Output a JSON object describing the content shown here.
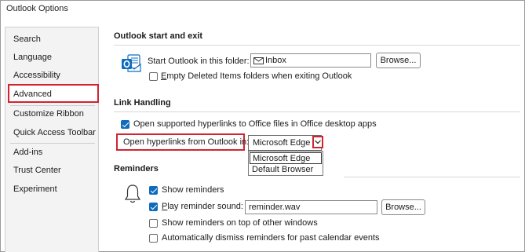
{
  "window": {
    "title": "Outlook Options"
  },
  "sidebar": {
    "items": [
      {
        "label": "Search"
      },
      {
        "label": "Language"
      },
      {
        "label": "Accessibility"
      },
      {
        "label": "Advanced"
      },
      {
        "label": "Customize Ribbon"
      },
      {
        "label": "Quick Access Toolbar"
      },
      {
        "label": "Add-ins"
      },
      {
        "label": "Trust Center"
      },
      {
        "label": "Experiment"
      }
    ],
    "selected": "Advanced"
  },
  "start_exit": {
    "title": "Outlook start and exit",
    "start_folder_label": "Start Outlook in this folder:",
    "start_folder_value": "Inbox",
    "browse_label": "Browse...",
    "empty_deleted_label": "Empty Deleted Items folders when exiting Outlook",
    "empty_deleted_checked": false
  },
  "link_handling": {
    "title": "Link Handling",
    "open_supported_label": "Open supported hyperlinks to Office files in Office desktop apps",
    "open_supported_checked": true,
    "open_from_label": "Open hyperlinks from Outlook in:",
    "open_from_value": "Microsoft Edge",
    "options": [
      "Microsoft Edge",
      "Default Browser"
    ]
  },
  "reminders": {
    "title": "Reminders",
    "show_label": "Show reminders",
    "show_checked": true,
    "play_sound_label": "Play reminder sound:",
    "play_sound_checked": true,
    "sound_file": "reminder.wav",
    "browse_label": "Browse...",
    "on_top_label": "Show reminders on top of other windows",
    "on_top_checked": false,
    "auto_dismiss_label": "Automatically dismiss reminders for past calendar events",
    "auto_dismiss_checked": false
  },
  "colors": {
    "highlight": "#d1242f",
    "checkbox": "#0f6cbd",
    "outlook_icon": "#0f6cbd"
  }
}
